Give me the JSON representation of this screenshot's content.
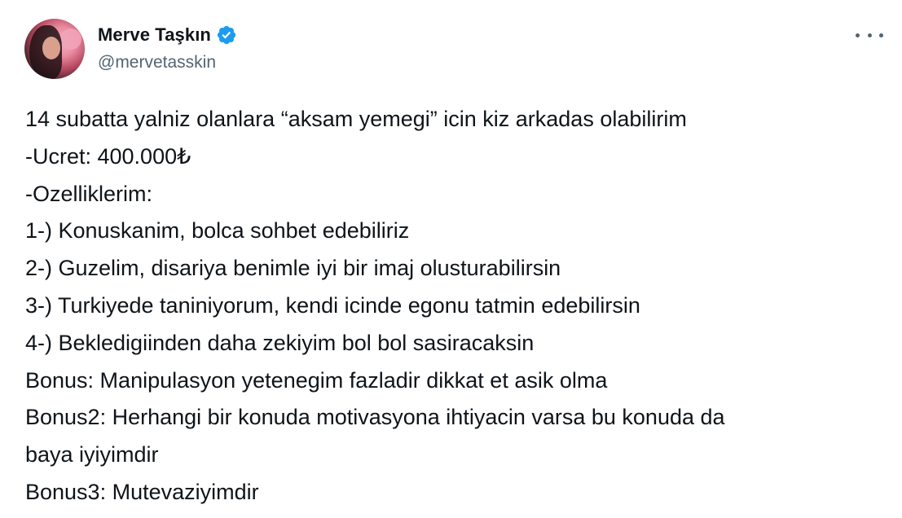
{
  "user": {
    "display_name": "Merve Taşkın",
    "handle": "@mervetasskin",
    "verified": true,
    "verified_icon": "verified-badge-icon",
    "verified_color": "#1d9bf0"
  },
  "menu": {
    "icon": "more-horizontal-icon"
  },
  "tweet": {
    "lines": [
      "14 subatta yalniz olanlara “aksam yemegi” icin kiz arkadas olabilirim",
      "-Ucret: 400.000₺",
      "-Ozelliklerim:",
      "1-) Konuskanim, bolca sohbet edebiliriz",
      "2-) Guzelim, disariya benimle iyi bir imaj olusturabilirsin",
      "3-) Turkiyede taniniyorum, kendi icinde egonu tatmin edebilirsin",
      "4-) Bekledigiinden daha zekiyim bol bol sasiracaksin",
      "Bonus: Manipulasyon yetenegim fazladir dikkat et asik olma",
      "Bonus2: Herhangi bir konuda motivasyona ihtiyacin varsa bu konuda da",
      "baya iyiyimdir",
      "Bonus3: Mutevaziyimdir"
    ]
  }
}
